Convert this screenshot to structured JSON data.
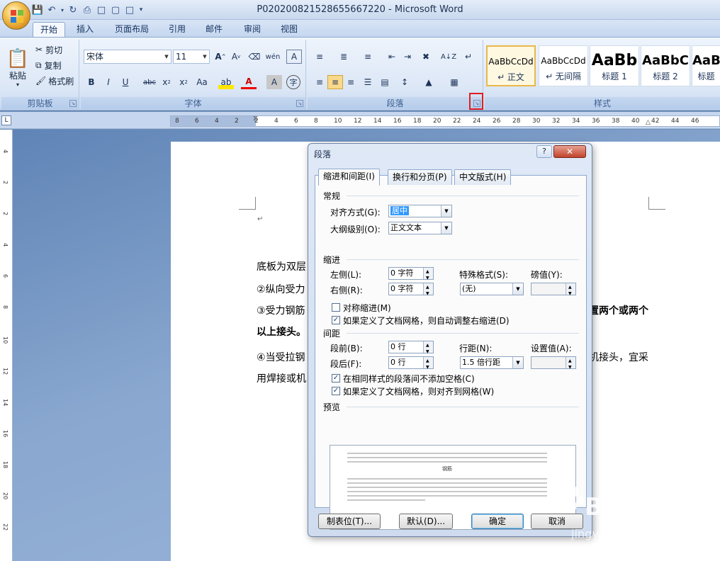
{
  "window": {
    "title": "P020200821528655667220 - Microsoft Word"
  },
  "ribbon": {
    "tabs": [
      "开始",
      "插入",
      "页面布局",
      "引用",
      "邮件",
      "审阅",
      "视图"
    ],
    "active_tab": "开始",
    "clipboard": {
      "label": "剪贴板",
      "paste": "粘贴",
      "cut": "剪切",
      "copy": "复制",
      "format_painter": "格式刷"
    },
    "font": {
      "label": "字体",
      "font_name": "宋体",
      "font_size": "11"
    },
    "paragraph": {
      "label": "段落"
    },
    "styles": {
      "label": "样式",
      "tiles": [
        {
          "sample": "AaBbCcDd",
          "name": "↵ 正文"
        },
        {
          "sample": "AaBbCcDd",
          "name": "↵ 无间隔"
        },
        {
          "sample": "AaBb",
          "name": "标题 1"
        },
        {
          "sample": "AaBbC",
          "name": "标题 2"
        },
        {
          "sample": "AaB",
          "name": "标题"
        }
      ]
    }
  },
  "ruler": {
    "ticks": [
      "8",
      "6",
      "4",
      "2",
      "2",
      "4",
      "6",
      "8",
      "10",
      "12",
      "14",
      "16",
      "18",
      "20",
      "22",
      "24",
      "26",
      "28",
      "30",
      "32",
      "34",
      "36",
      "38",
      "40",
      "42",
      "44",
      "46"
    ],
    "vticks": [
      "4",
      "2",
      "2",
      "4",
      "6",
      "8",
      "10",
      "12",
      "14",
      "16",
      "18",
      "20",
      "22"
    ]
  },
  "document": {
    "lines": [
      "底板为双层",
      "②纵向受力",
      "③受力钢筋",
      "以上接头。",
      "④当受拉钢",
      "用焊接或机"
    ],
    "right_fragments": [
      "置两个或两个",
      "机接头，宜采"
    ]
  },
  "dialog": {
    "title": "段落",
    "help": "?",
    "close": "✕",
    "tabs": [
      "缩进和间距(I)",
      "换行和分页(P)",
      "中文版式(H)"
    ],
    "general": {
      "section": "常规",
      "alignment_label": "对齐方式(G):",
      "alignment_value": "居中",
      "outline_label": "大纲级别(O):",
      "outline_value": "正文文本"
    },
    "indent": {
      "section": "缩进",
      "left_label": "左侧(L):",
      "left_value": "0 字符",
      "right_label": "右侧(R):",
      "right_value": "0 字符",
      "special_label": "特殊格式(S):",
      "special_value": "(无)",
      "by_label": "磅值(Y):",
      "by_value": "",
      "mirror_label": "对称缩进(M)",
      "mirror_checked": false,
      "auto_right_label": "如果定义了文档网格，则自动调整右缩进(D)",
      "auto_right_checked": true
    },
    "spacing": {
      "section": "间距",
      "before_label": "段前(B):",
      "before_value": "0 行",
      "after_label": "段后(F):",
      "after_value": "0 行",
      "line_label": "行距(N):",
      "line_value": "1.5 倍行距",
      "at_label": "设置值(A):",
      "at_value": "",
      "no_space_label": "在相同样式的段落间不添加空格(C)",
      "no_space_checked": true,
      "snap_grid_label": "如果定义了文档网格，则对齐到网格(W)",
      "snap_grid_checked": true
    },
    "preview": {
      "section": "预览",
      "sample_text": "钢筋"
    },
    "buttons": {
      "tabs": "制表位(T)...",
      "default": "默认(D)...",
      "ok": "确定",
      "cancel": "取消"
    }
  },
  "watermark": {
    "brand": "Baidu经验",
    "url": "jingyan.baidu.com"
  }
}
